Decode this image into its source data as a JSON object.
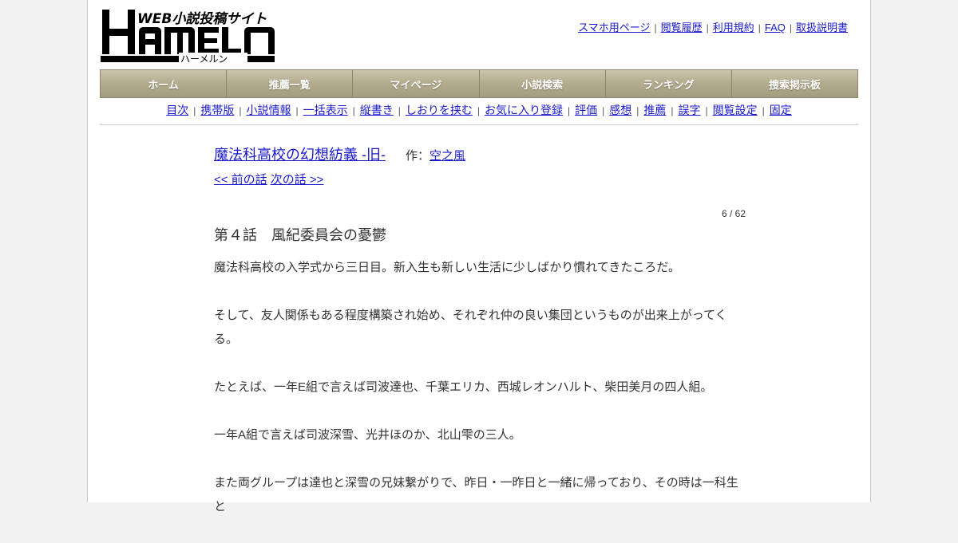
{
  "site": {
    "tagline": "WEB小説投稿サイト",
    "logo_text": "HAMELN",
    "logo_kana": "ハーメルン"
  },
  "top_links": [
    "スマホ用ページ",
    "閲覧履歴",
    "利用規約",
    "FAQ",
    "取扱説明書"
  ],
  "main_nav": [
    "ホーム",
    "推薦一覧",
    "マイページ",
    "小説検索",
    "ランキング",
    "捜索掲示板"
  ],
  "sub_nav": [
    "目次",
    "携帯版",
    "小説情報",
    "一括表示",
    "縦書き",
    "しおりを挟む",
    "お気に入り登録",
    "評価",
    "感想",
    "推薦",
    "誤字",
    "閲覧設定",
    "固定"
  ],
  "novel": {
    "title": "魔法科高校の幻想紡義 -旧-",
    "author_label": "作：",
    "author": "空之風",
    "prev": "<< 前の話",
    "next": "次の話 >>",
    "progress": "6 / 62",
    "chapter_title": "第４話　風紀委員会の憂鬱",
    "paragraphs": [
      "魔法科高校の入学式から三日目。新入生も新しい生活に少しばかり慣れてきたころだ。",
      "そして、友人関係もある程度構築され始め、それぞれ仲の良い集団というものが出来上がってくる。",
      "たとえば、一年E組で言えば司波達也、千葉エリカ、西城レオンハルト、柴田美月の四人組。",
      "一年A組で言えば司波深雪、光井ほのか、北山雫の三人。",
      "また両グループは達也と深雪の兄妹繋がりで、昨日・一昨日と一緒に帰っており、その時は一科生と"
    ]
  },
  "colors": {
    "link": "#1a1acc",
    "nav_bg": "#b4ad90",
    "nav_text": "#ffffff",
    "page_bg": "#f2f2f2"
  }
}
